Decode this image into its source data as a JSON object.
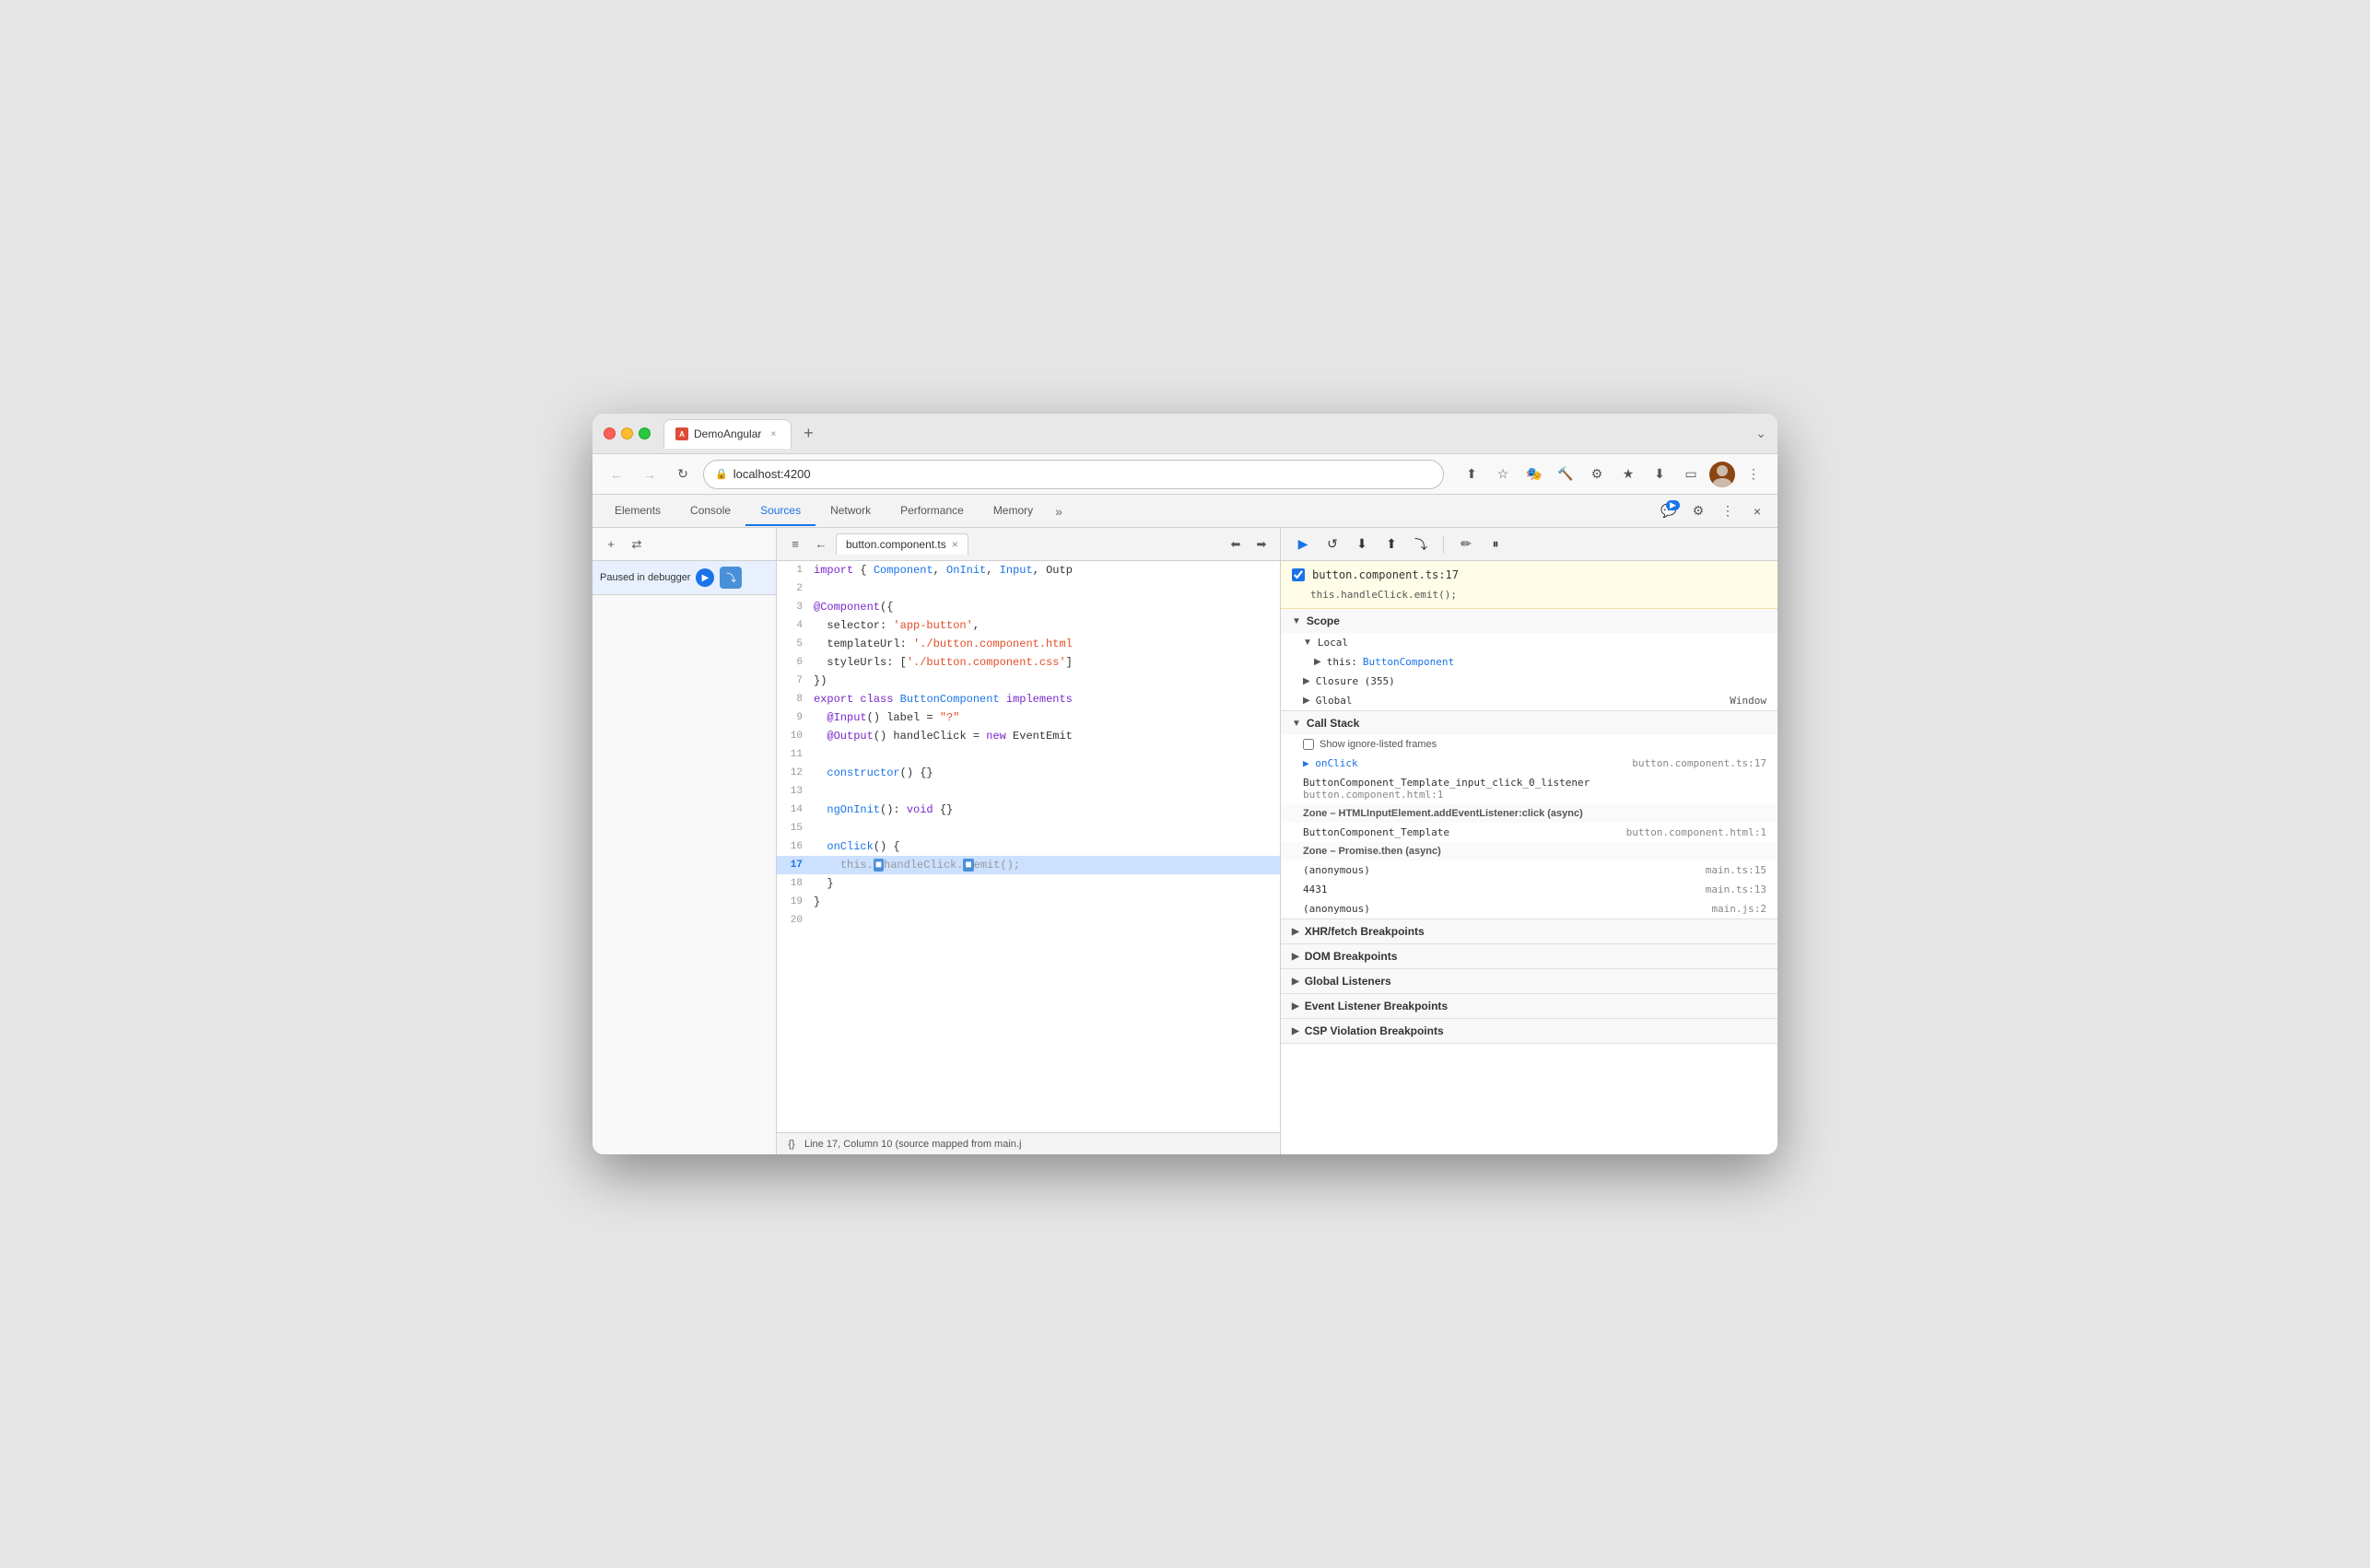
{
  "browser": {
    "tab_title": "DemoAngular",
    "tab_close": "×",
    "new_tab": "+",
    "tab_expand": "⌄",
    "address": "localhost:4200",
    "back_btn": "←",
    "forward_btn": "→",
    "refresh_btn": "↻"
  },
  "devtools": {
    "tabs": [
      "Elements",
      "Console",
      "Sources",
      "Network",
      "Performance",
      "Memory"
    ],
    "active_tab": "Sources",
    "more_tabs": "»",
    "chat_badge": "1",
    "actions": [
      "⚙",
      "⋮",
      "×"
    ]
  },
  "sidebar": {
    "add_btn": "+",
    "nav_btn": "↕",
    "status_text": "Paused in debugger",
    "resume_icon": "▶",
    "step_icon": "⤵"
  },
  "editor": {
    "file_name": "button.component.ts",
    "file_close": "×",
    "format_btn": "{}",
    "status_line": "Line 17, Column 10 (source mapped from main.j",
    "code_lines": [
      {
        "num": "1",
        "content": "import { Component, OnInit, Input, Outp",
        "parts": []
      },
      {
        "num": "2",
        "content": "",
        "parts": []
      },
      {
        "num": "3",
        "content": "@Component({",
        "parts": []
      },
      {
        "num": "4",
        "content": "  selector: 'app-button',",
        "parts": []
      },
      {
        "num": "5",
        "content": "  templateUrl: './button.component.html",
        "parts": []
      },
      {
        "num": "6",
        "content": "  styleUrls: ['./button.component.css']",
        "parts": []
      },
      {
        "num": "7",
        "content": "})",
        "parts": []
      },
      {
        "num": "8",
        "content": "export class ButtonComponent implements",
        "parts": []
      },
      {
        "num": "9",
        "content": "  @Input() label = \"?\"",
        "parts": []
      },
      {
        "num": "10",
        "content": "  @Output() handleClick = new EventEmit",
        "parts": []
      },
      {
        "num": "11",
        "content": "",
        "parts": []
      },
      {
        "num": "12",
        "content": "  constructor() {}",
        "parts": []
      },
      {
        "num": "13",
        "content": "",
        "parts": []
      },
      {
        "num": "14",
        "content": "  ngOnInit(): void {}",
        "parts": []
      },
      {
        "num": "15",
        "content": "",
        "parts": []
      },
      {
        "num": "16",
        "content": "  onClick() {",
        "parts": []
      },
      {
        "num": "17",
        "content": "    this.handleClick.emit();",
        "active": true,
        "parts": []
      },
      {
        "num": "18",
        "content": "  }",
        "parts": []
      },
      {
        "num": "19",
        "content": "}",
        "parts": []
      },
      {
        "num": "20",
        "content": "",
        "parts": []
      }
    ]
  },
  "right_panel": {
    "toolbar_btns": [
      "▶",
      "↺",
      "⬇",
      "⬆",
      "⤵",
      "✏",
      "⏸"
    ],
    "breakpoint": {
      "checked": true,
      "file": "button.component.ts:17",
      "code": "this.handleClick.emit();"
    },
    "scope": {
      "label": "Scope",
      "sections": [
        {
          "label": "Local",
          "expanded": true,
          "items": [
            {
              "key": "▶ this",
              "val": "ButtonComponent"
            }
          ]
        },
        {
          "label": "Closure (355)",
          "expanded": false,
          "items": []
        },
        {
          "label": "Global",
          "expanded": false,
          "items": [],
          "extra": "Window"
        }
      ]
    },
    "call_stack": {
      "label": "Call Stack",
      "show_ignored": "Show ignore-listed frames",
      "frames": [
        {
          "name": "onClick",
          "location": "button.component.ts:17",
          "active": true
        },
        {
          "name": "ButtonComponent_Template_input_click_0_listener",
          "location": "",
          "sub": "button.component.html:1"
        },
        {
          "zone": "Zone – HTMLInputElement.addEventListener:click (async)"
        },
        {
          "name": "ButtonComponent_Template",
          "location": "button.component.html:1"
        },
        {
          "zone": "Zone – Promise.then (async)"
        },
        {
          "name": "(anonymous)",
          "location": "main.ts:15"
        },
        {
          "name": "4431",
          "location": "main.ts:13"
        },
        {
          "name": "(anonymous)",
          "location": "main.js:2"
        }
      ]
    },
    "breakpoint_sections": [
      {
        "label": "XHR/fetch Breakpoints",
        "expanded": false
      },
      {
        "label": "DOM Breakpoints",
        "expanded": false
      },
      {
        "label": "Global Listeners",
        "expanded": false
      },
      {
        "label": "Event Listener Breakpoints",
        "expanded": false
      },
      {
        "label": "CSP Violation Breakpoints",
        "expanded": false
      }
    ]
  }
}
